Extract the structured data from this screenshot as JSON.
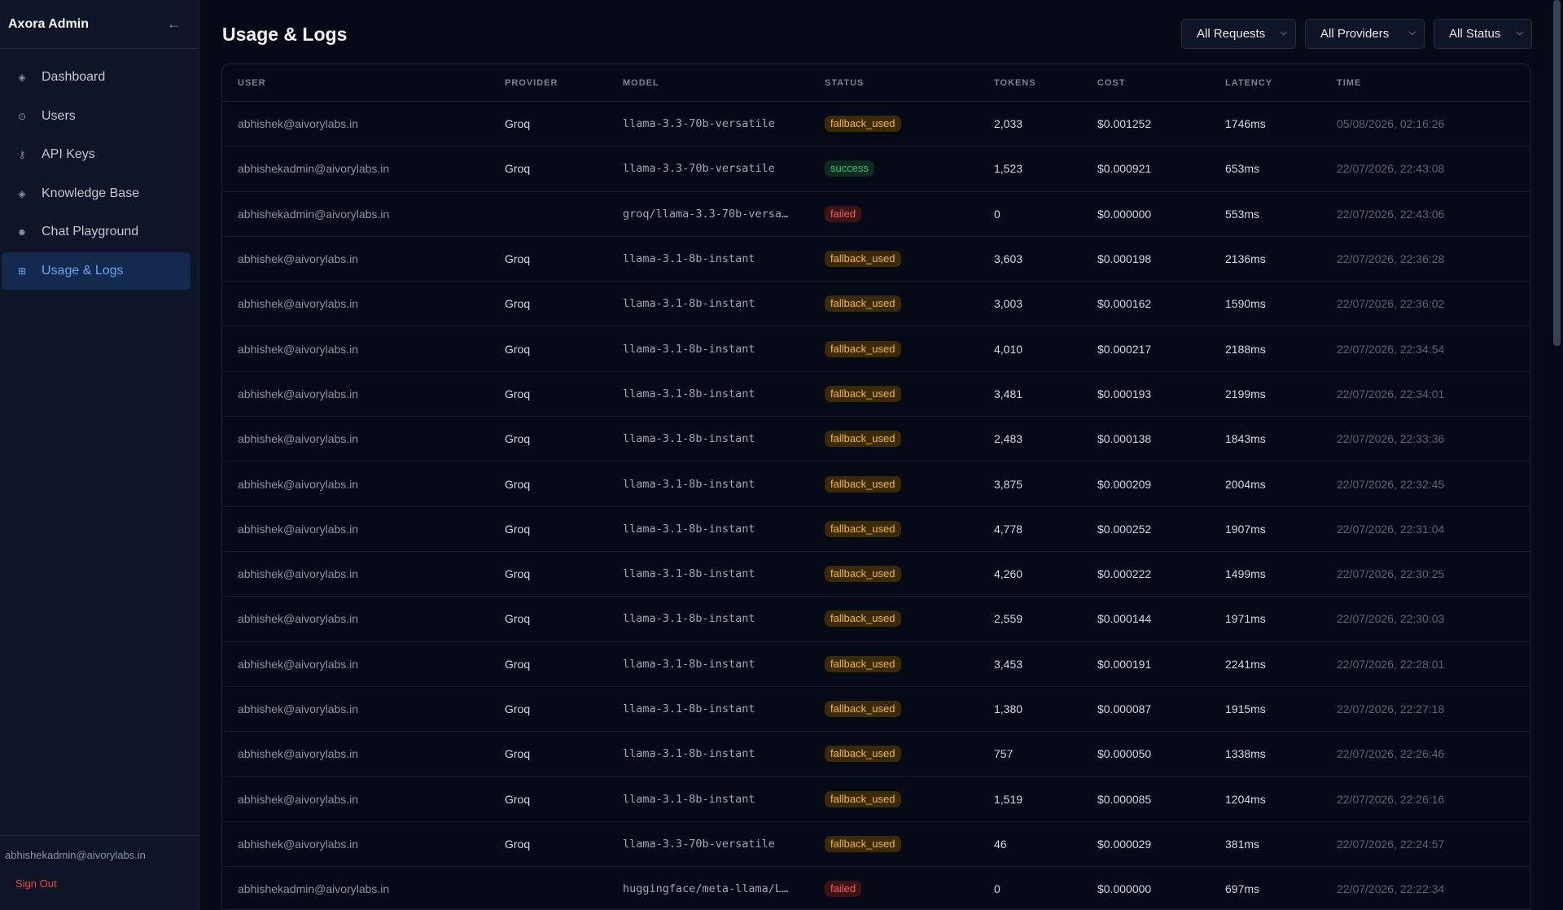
{
  "sidebar": {
    "brand": "Axora Admin",
    "items": [
      {
        "label": "Dashboard",
        "icon": "◈",
        "name": "dashboard"
      },
      {
        "label": "Users",
        "icon": "⊙",
        "name": "users"
      },
      {
        "label": "API Keys",
        "icon": "⚷",
        "name": "api-keys"
      },
      {
        "label": "Knowledge Base",
        "icon": "◈",
        "name": "knowledge-base"
      },
      {
        "label": "Chat Playground",
        "icon": "☻",
        "name": "chat-playground"
      },
      {
        "label": "Usage & Logs",
        "icon": "⊞",
        "name": "usage-logs",
        "active": true
      }
    ],
    "user_email": "abhishekadmin@aivorylabs.in",
    "sign_out": "Sign Out"
  },
  "header": {
    "title": "Usage & Logs",
    "filters": [
      "All Requests",
      "All Providers",
      "All Status"
    ]
  },
  "table": {
    "columns": [
      "USER",
      "PROVIDER",
      "MODEL",
      "STATUS",
      "TOKENS",
      "COST",
      "LATENCY",
      "TIME"
    ],
    "rows": [
      {
        "user": "abhishek@aivorylabs.in",
        "provider": "Groq",
        "model": "llama-3.3-70b-versatile",
        "status": "fallback_used",
        "tokens": "2,033",
        "cost": "$0.001252",
        "latency": "1746ms",
        "time": "05/08/2026, 02:16:26"
      },
      {
        "user": "abhishekadmin@aivorylabs.in",
        "provider": "Groq",
        "model": "llama-3.3-70b-versatile",
        "status": "success",
        "tokens": "1,523",
        "cost": "$0.000921",
        "latency": "653ms",
        "time": "22/07/2026, 22:43:08"
      },
      {
        "user": "abhishekadmin@aivorylabs.in",
        "provider": "",
        "model": "groq/llama-3.3-70b-versa…",
        "status": "failed",
        "tokens": "0",
        "cost": "$0.000000",
        "latency": "553ms",
        "time": "22/07/2026, 22:43:06"
      },
      {
        "user": "abhishek@aivorylabs.in",
        "provider": "Groq",
        "model": "llama-3.1-8b-instant",
        "status": "fallback_used",
        "tokens": "3,603",
        "cost": "$0.000198",
        "latency": "2136ms",
        "time": "22/07/2026, 22:36:28"
      },
      {
        "user": "abhishek@aivorylabs.in",
        "provider": "Groq",
        "model": "llama-3.1-8b-instant",
        "status": "fallback_used",
        "tokens": "3,003",
        "cost": "$0.000162",
        "latency": "1590ms",
        "time": "22/07/2026, 22:36:02"
      },
      {
        "user": "abhishek@aivorylabs.in",
        "provider": "Groq",
        "model": "llama-3.1-8b-instant",
        "status": "fallback_used",
        "tokens": "4,010",
        "cost": "$0.000217",
        "latency": "2188ms",
        "time": "22/07/2026, 22:34:54"
      },
      {
        "user": "abhishek@aivorylabs.in",
        "provider": "Groq",
        "model": "llama-3.1-8b-instant",
        "status": "fallback_used",
        "tokens": "3,481",
        "cost": "$0.000193",
        "latency": "2199ms",
        "time": "22/07/2026, 22:34:01"
      },
      {
        "user": "abhishek@aivorylabs.in",
        "provider": "Groq",
        "model": "llama-3.1-8b-instant",
        "status": "fallback_used",
        "tokens": "2,483",
        "cost": "$0.000138",
        "latency": "1843ms",
        "time": "22/07/2026, 22:33:36"
      },
      {
        "user": "abhishek@aivorylabs.in",
        "provider": "Groq",
        "model": "llama-3.1-8b-instant",
        "status": "fallback_used",
        "tokens": "3,875",
        "cost": "$0.000209",
        "latency": "2004ms",
        "time": "22/07/2026, 22:32:45"
      },
      {
        "user": "abhishek@aivorylabs.in",
        "provider": "Groq",
        "model": "llama-3.1-8b-instant",
        "status": "fallback_used",
        "tokens": "4,778",
        "cost": "$0.000252",
        "latency": "1907ms",
        "time": "22/07/2026, 22:31:04"
      },
      {
        "user": "abhishek@aivorylabs.in",
        "provider": "Groq",
        "model": "llama-3.1-8b-instant",
        "status": "fallback_used",
        "tokens": "4,260",
        "cost": "$0.000222",
        "latency": "1499ms",
        "time": "22/07/2026, 22:30:25"
      },
      {
        "user": "abhishek@aivorylabs.in",
        "provider": "Groq",
        "model": "llama-3.1-8b-instant",
        "status": "fallback_used",
        "tokens": "2,559",
        "cost": "$0.000144",
        "latency": "1971ms",
        "time": "22/07/2026, 22:30:03"
      },
      {
        "user": "abhishek@aivorylabs.in",
        "provider": "Groq",
        "model": "llama-3.1-8b-instant",
        "status": "fallback_used",
        "tokens": "3,453",
        "cost": "$0.000191",
        "latency": "2241ms",
        "time": "22/07/2026, 22:28:01"
      },
      {
        "user": "abhishek@aivorylabs.in",
        "provider": "Groq",
        "model": "llama-3.1-8b-instant",
        "status": "fallback_used",
        "tokens": "1,380",
        "cost": "$0.000087",
        "latency": "1915ms",
        "time": "22/07/2026, 22:27:18"
      },
      {
        "user": "abhishek@aivorylabs.in",
        "provider": "Groq",
        "model": "llama-3.1-8b-instant",
        "status": "fallback_used",
        "tokens": "757",
        "cost": "$0.000050",
        "latency": "1338ms",
        "time": "22/07/2026, 22:26:46"
      },
      {
        "user": "abhishek@aivorylabs.in",
        "provider": "Groq",
        "model": "llama-3.1-8b-instant",
        "status": "fallback_used",
        "tokens": "1,519",
        "cost": "$0.000085",
        "latency": "1204ms",
        "time": "22/07/2026, 22:26:16"
      },
      {
        "user": "abhishek@aivorylabs.in",
        "provider": "Groq",
        "model": "llama-3.3-70b-versatile",
        "status": "fallback_used",
        "tokens": "46",
        "cost": "$0.000029",
        "latency": "381ms",
        "time": "22/07/2026, 22:24:57"
      },
      {
        "user": "abhishekadmin@aivorylabs.in",
        "provider": "",
        "model": "huggingface/meta-llama/L…",
        "status": "failed",
        "tokens": "0",
        "cost": "$0.000000",
        "latency": "697ms",
        "time": "22/07/2026, 22:22:34"
      }
    ]
  },
  "colors": {
    "background": "#050a16",
    "sidebar": "#0d1526",
    "accent": "#6ba4f2",
    "status_fallback": "#f5b82e",
    "status_success": "#37c47a",
    "status_failed": "#f06060",
    "sign_out": "#ef4444"
  },
  "icons": {
    "collapse": "arrow-left-icon",
    "filter_chevron": "chevron-down-icon"
  }
}
